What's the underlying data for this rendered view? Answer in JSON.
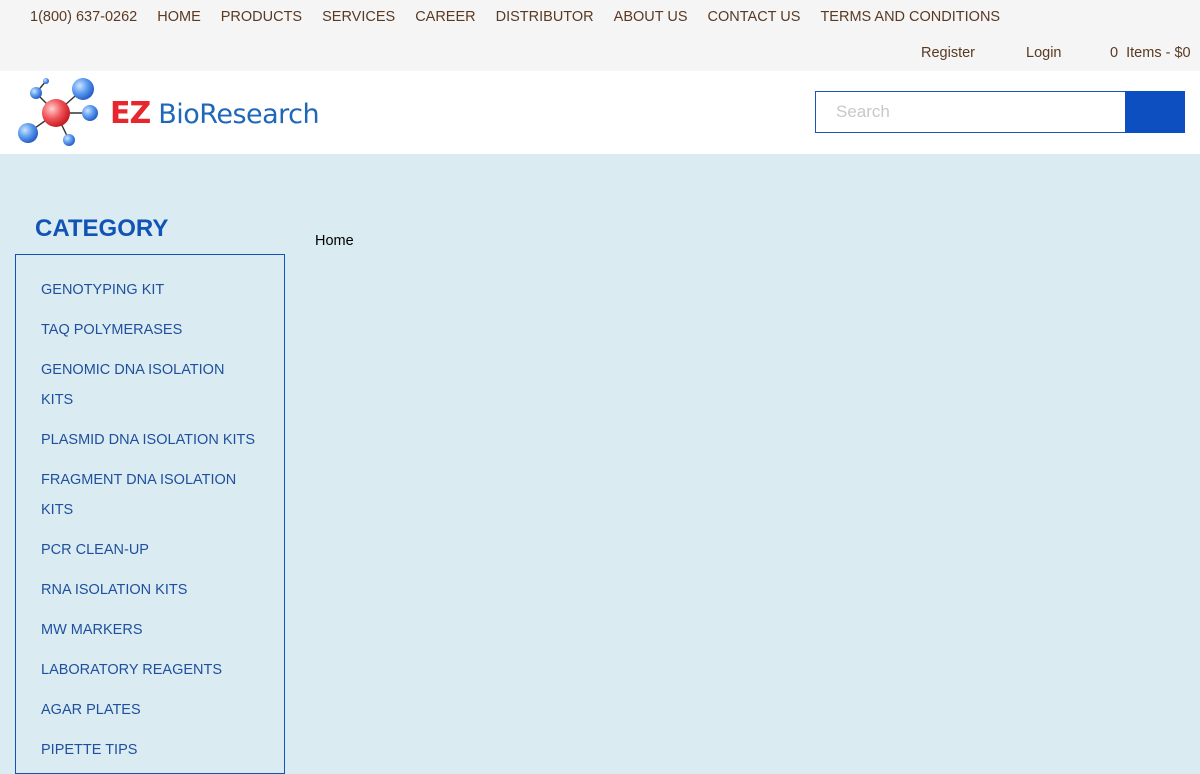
{
  "topbar": {
    "phone": "1(800) 637-0262",
    "nav": [
      "HOME",
      "PRODUCTS",
      "SERVICES",
      "CAREER",
      "DISTRIBUTOR",
      "ABOUT US",
      "CONTACT US",
      "TERMS AND CONDITIONS"
    ],
    "register": "Register",
    "login": "Login",
    "cart": "0  Items - $0"
  },
  "header": {
    "logo_ez": "EZ",
    "logo_bio": "BioResearch",
    "search_placeholder": "Search"
  },
  "sidebar": {
    "title": "CATEGORY",
    "items": [
      "GENOTYPING KIT",
      "TAQ POLYMERASES",
      "GENOMIC DNA ISOLATION KITS",
      "PLASMID DNA ISOLATION KITS",
      "FRAGMENT DNA ISOLATION KITS",
      "PCR CLEAN-UP",
      "RNA ISOLATION KITS",
      "MW MARKERS",
      "LABORATORY REAGENTS",
      "AGAR PLATES",
      "PIPETTE TIPS"
    ]
  },
  "breadcrumb": "Home",
  "colors": {
    "page_background": "#daecf2",
    "brand_blue": "#1254b6",
    "search_button": "#0d4fc0",
    "logo_red": "#e8262d",
    "nav_text": "#5a3a22"
  }
}
